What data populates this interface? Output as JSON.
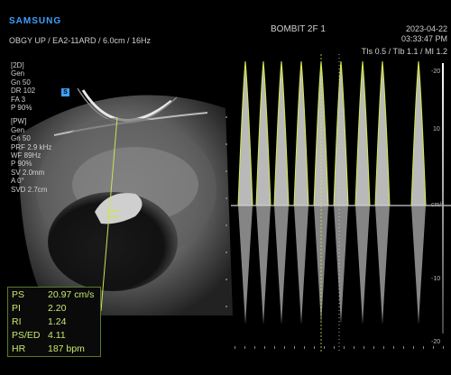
{
  "brand": "SAMSUNG",
  "header": {
    "patient_title": "BOMBIT 2F 1",
    "date": "2023-04-22",
    "time": "03:33:47 PM",
    "probe_line": "OBGY UP / EA2-11ARD / 6.0cm / 16Hz",
    "tis_line": "TIs  0.5 / TIb  1.1 / MI  1.2"
  },
  "params": {
    "mode_2d": "[2D]",
    "gen_2d": "Gen",
    "gn_2d": "Gn   50",
    "dr": "DR   102",
    "fa": "FA   3",
    "p_2d": "P     90%",
    "mode_pw": "[PW]",
    "gen_pw": "Gen",
    "gn_pw": "Gn   50",
    "prf": "PRF  2.9 kHz",
    "wf": "WF   89Hz",
    "p_pw": "P     90%",
    "sv": "SV   2.0mm",
    "angle": "A     0°",
    "svd": "SVD  2.7cm",
    "s_marker": "S"
  },
  "measurements": [
    {
      "label": "PS",
      "value": "20.97 cm/s"
    },
    {
      "label": "PI",
      "value": "2.20"
    },
    {
      "label": "RI",
      "value": "1.24"
    },
    {
      "label": "PS/ED",
      "value": "4.11"
    },
    {
      "label": "HR",
      "value": "187 bpm"
    }
  ],
  "scale": {
    "top": "-20",
    "upper": "10",
    "unit": "cm/s",
    "lower": "-10",
    "bottom": "-20"
  },
  "colors": {
    "accent_blue": "#3fa0ff",
    "measurement_green": "#c7e870",
    "trace_yellow": "#d6e84a"
  }
}
